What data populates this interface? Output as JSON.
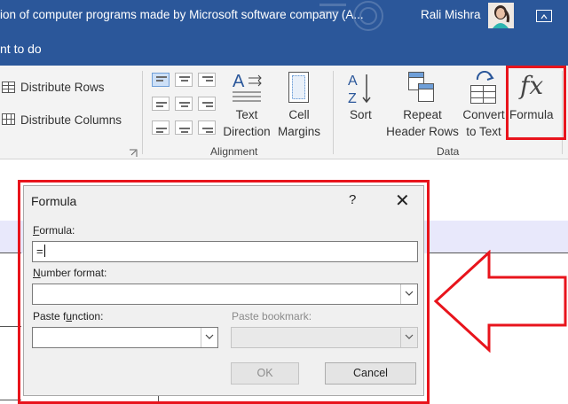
{
  "titlebar": {
    "title": "ion of computer programs made by Microsoft software company (A...",
    "user": "Rali Mishra"
  },
  "tellbar": {
    "text": "nt to do"
  },
  "ribbon": {
    "merge": {
      "distribute_rows": "Distribute Rows",
      "distribute_columns": "Distribute Columns"
    },
    "alignment": {
      "text_direction_line1": "Text",
      "text_direction_line2": "Direction",
      "cell_margins_line1": "Cell",
      "cell_margins_line2": "Margins",
      "group_label": "Alignment"
    },
    "data": {
      "sort": "Sort",
      "repeat_line1": "Repeat",
      "repeat_line2": "Header Rows",
      "convert_line1": "Convert",
      "convert_line2": "to Text",
      "formula": "Formula",
      "formula_glyph": "fx",
      "group_label": "Data"
    }
  },
  "dialog": {
    "title": "Formula",
    "help": "?",
    "close": "✕",
    "formula_label_underlined": "F",
    "formula_label_rest": "ormula:",
    "formula_value": "=",
    "number_format_label_underlined": "N",
    "number_format_label_rest": "umber format:",
    "number_format_value": "",
    "paste_function_label_pre": "Paste f",
    "paste_function_label_underlined": "u",
    "paste_function_label_rest": "nction:",
    "paste_bookmark_label": "Paste bookmark:",
    "ok": "OK",
    "cancel": "Cancel"
  },
  "colors": {
    "accent": "#2b579a",
    "highlight_red": "#e8141c",
    "ribbon_bg": "#f3f3f3"
  }
}
